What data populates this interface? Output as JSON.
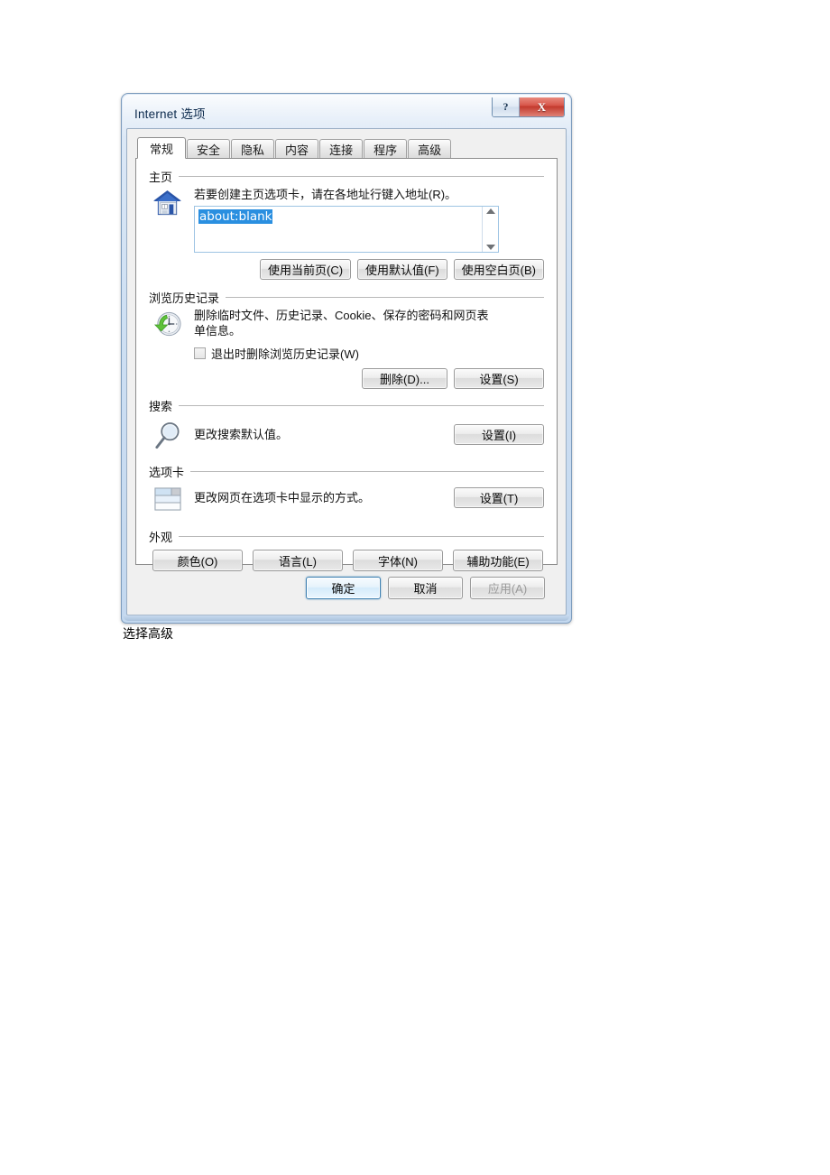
{
  "window": {
    "title": "Internet 选项",
    "caption_buttons": [
      {
        "name": "help",
        "glyph": "?"
      },
      {
        "name": "close",
        "glyph": "X"
      }
    ]
  },
  "tabs": [
    {
      "label": "常规",
      "active": true
    },
    {
      "label": "安全",
      "active": false
    },
    {
      "label": "隐私",
      "active": false
    },
    {
      "label": "内容",
      "active": false
    },
    {
      "label": "连接",
      "active": false
    },
    {
      "label": "程序",
      "active": false
    },
    {
      "label": "高级",
      "active": false
    }
  ],
  "home_page": {
    "group_title": "主页",
    "icon": "home-icon",
    "description": "若要创建主页选项卡，请在各地址行键入地址(R)。",
    "address_value": "about:blank",
    "address_selected": true,
    "buttons": [
      {
        "label": "使用当前页(C)"
      },
      {
        "label": "使用默认值(F)"
      },
      {
        "label": "使用空白页(B)"
      }
    ]
  },
  "browsing_history": {
    "group_title": "浏览历史记录",
    "icon": "history-clock-icon",
    "description": "删除临时文件、历史记录、Cookie、保存的密码和网页表单信息。",
    "checkbox": {
      "label": "退出时删除浏览历史记录(W)",
      "checked": false
    },
    "buttons": [
      {
        "label": "删除(D)..."
      },
      {
        "label": "设置(S)"
      }
    ]
  },
  "search": {
    "group_title": "搜索",
    "icon": "magnifier-icon",
    "description": "更改搜索默认值。",
    "button": {
      "label": "设置(I)"
    }
  },
  "tabs_section": {
    "group_title": "选项卡",
    "icon": "tabs-icon",
    "description": "更改网页在选项卡中显示的方式。",
    "button": {
      "label": "设置(T)"
    }
  },
  "appearance": {
    "group_title": "外观",
    "buttons": [
      {
        "label": "颜色(O)"
      },
      {
        "label": "语言(L)"
      },
      {
        "label": "字体(N)"
      },
      {
        "label": "辅助功能(E)"
      }
    ]
  },
  "footer": {
    "ok": "确定",
    "cancel": "取消",
    "apply": "应用(A)",
    "apply_disabled": true
  },
  "caption": "选择高级",
  "colors": {
    "frame": "#c3d8ef",
    "close_button": "#c33a2d",
    "selection": "#2a8fe0",
    "default_button_border": "#3c7fb1"
  }
}
